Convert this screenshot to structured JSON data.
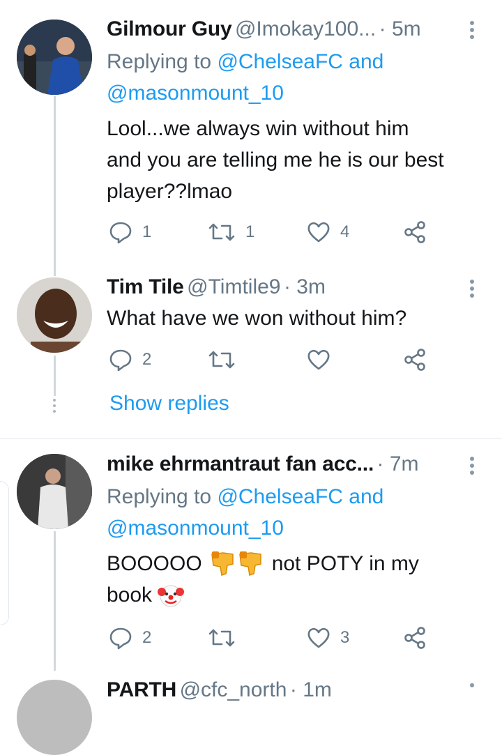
{
  "tweets": [
    {
      "display_name": "Gilmour Guy",
      "handle": "@Imokay100...",
      "time": "· 5m",
      "replying_prefix": "Replying to ",
      "replying_user1": "@ChelseaFC",
      "replying_and": " and",
      "replying_user2": "@masonmount_10",
      "text_lines": [
        "Lool...we always win without him",
        "and you are telling me he is our best",
        "player??lmao"
      ],
      "replies": "1",
      "retweets": "1",
      "likes": "4"
    },
    {
      "display_name": "Tim Tile",
      "handle": "@Timtile9",
      "time": "· 3m",
      "text_lines": [
        "What have we won without him?"
      ],
      "replies": "2",
      "retweets": "",
      "likes": ""
    },
    {
      "display_name": "mike ehrmantraut fan acc...",
      "handle": "",
      "time": "· 7m",
      "replying_prefix": "Replying to ",
      "replying_user1": "@ChelseaFC",
      "replying_and": " and",
      "replying_user2": "@masonmount_10",
      "text_lines": [
        "BOOOOO",
        "not POTY in my",
        "book"
      ],
      "replies": "2",
      "retweets": "",
      "likes": "3"
    },
    {
      "display_name": "PARTH",
      "handle": "@cfc_north",
      "time": "· 1m"
    }
  ],
  "show_replies": "Show replies",
  "icons": {
    "reply": "reply-icon",
    "retweet": "retweet-icon",
    "like": "heart-icon",
    "share": "share-icon",
    "more": "more-vertical-icon",
    "thumbs_down": "thumbs-down-emoji",
    "clown": "clown-emoji"
  },
  "colors": {
    "accent": "#1d9bf0",
    "secondary_text": "#657786",
    "thread_line": "#cfd9de"
  }
}
